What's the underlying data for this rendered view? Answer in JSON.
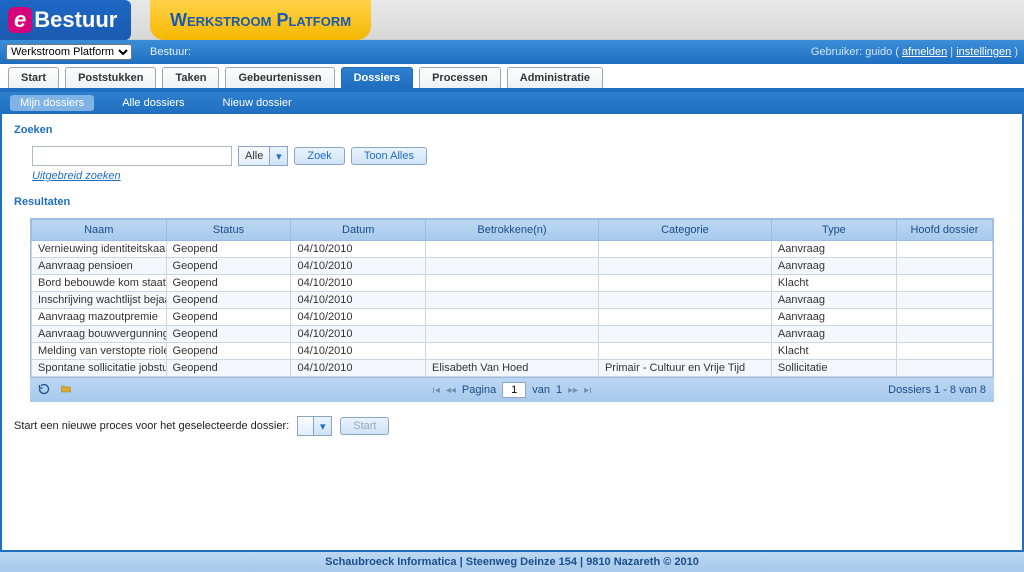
{
  "brand": {
    "prefix": "e",
    "name": "Bestuur"
  },
  "platform_tab": "Werkstroom Platform",
  "context": {
    "selector_value": "Werkstroom Platform",
    "bestuur_label": "Bestuur:",
    "user_label": "Gebruiker:",
    "user_name": "guido",
    "logout": "afmelden",
    "settings": "instellingen"
  },
  "main_tabs": [
    "Start",
    "Poststukken",
    "Taken",
    "Gebeurtenissen",
    "Dossiers",
    "Processen",
    "Administratie"
  ],
  "main_tab_active": 4,
  "sub_tabs": [
    "Mijn dossiers",
    "Alle dossiers",
    "Nieuw dossier"
  ],
  "sub_tab_active": 0,
  "search": {
    "title": "Zoeken",
    "input_value": "",
    "scope": "Alle",
    "btn_search": "Zoek",
    "btn_showall": "Toon Alles",
    "advanced": "Uitgebreid zoeken"
  },
  "results": {
    "title": "Resultaten",
    "columns": [
      "Naam",
      "Status",
      "Datum",
      "Betrokkene(n)",
      "Categorie",
      "Type",
      "Hoofd dossier"
    ],
    "rows": [
      {
        "naam": "Vernieuwing identiteitskaart",
        "status": "Geopend",
        "datum": "04/10/2010",
        "betrokkene": "",
        "categorie": "",
        "type": "Aanvraag",
        "hoofd": ""
      },
      {
        "naam": "Aanvraag pensioen",
        "status": "Geopend",
        "datum": "04/10/2010",
        "betrokkene": "",
        "categorie": "",
        "type": "Aanvraag",
        "hoofd": ""
      },
      {
        "naam": "Bord bebouwde kom staat verk",
        "status": "Geopend",
        "datum": "04/10/2010",
        "betrokkene": "",
        "categorie": "",
        "type": "Klacht",
        "hoofd": ""
      },
      {
        "naam": "Inschrijving wachtlijst bejaarde",
        "status": "Geopend",
        "datum": "04/10/2010",
        "betrokkene": "",
        "categorie": "",
        "type": "Aanvraag",
        "hoofd": ""
      },
      {
        "naam": "Aanvraag mazoutpremie",
        "status": "Geopend",
        "datum": "04/10/2010",
        "betrokkene": "",
        "categorie": "",
        "type": "Aanvraag",
        "hoofd": ""
      },
      {
        "naam": "Aanvraag bouwvergunning",
        "status": "Geopend",
        "datum": "04/10/2010",
        "betrokkene": "",
        "categorie": "",
        "type": "Aanvraag",
        "hoofd": ""
      },
      {
        "naam": "Melding van verstopte riolering",
        "status": "Geopend",
        "datum": "04/10/2010",
        "betrokkene": "",
        "categorie": "",
        "type": "Klacht",
        "hoofd": ""
      },
      {
        "naam": "Spontane sollicitatie jobstudent",
        "status": "Geopend",
        "datum": "04/10/2010",
        "betrokkene": "Elisabeth Van Hoed",
        "categorie": "Primair - Cultuur en Vrije Tijd",
        "type": "Sollicitatie",
        "hoofd": ""
      }
    ],
    "pager": {
      "label_page": "Pagina",
      "current": "1",
      "of_label": "van",
      "total": "1"
    },
    "count": "Dossiers 1 - 8 van 8"
  },
  "startproc": {
    "label": "Start een nieuwe proces voor het geselecteerde dossier:",
    "button": "Start"
  },
  "footer": "Schaubroeck Informatica | Steenweg Deinze 154 | 9810 Nazareth © 2010"
}
